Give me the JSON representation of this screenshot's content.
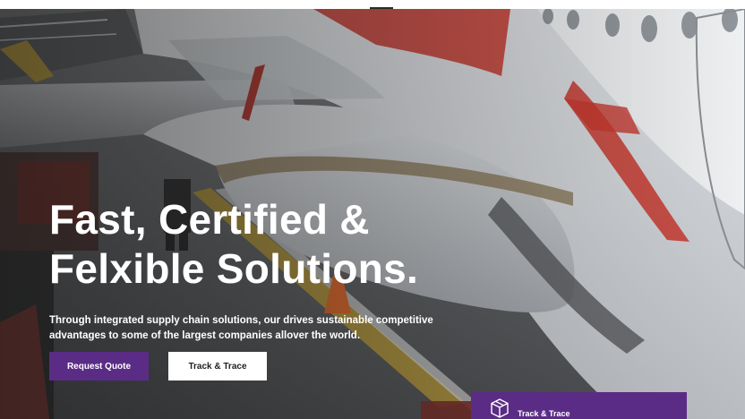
{
  "hero": {
    "headline_line1": "Fast, Certified &",
    "headline_line2": "Felxible Solutions.",
    "subtext_line1": "Through integrated supply chain solutions, our drives sustainable competitive",
    "subtext_line2": "advantages to some of the largest companies allover the world.",
    "request_quote_label": "Request Quote",
    "track_trace_label": "Track & Trace"
  },
  "track_card": {
    "label": "Track & Trace",
    "icon": "package-box-icon"
  },
  "background": {
    "description_icon": "airplane-photo"
  },
  "colors": {
    "accent": "#5b2c86",
    "text": "#ffffff",
    "airplane_red": "#c8372d"
  }
}
